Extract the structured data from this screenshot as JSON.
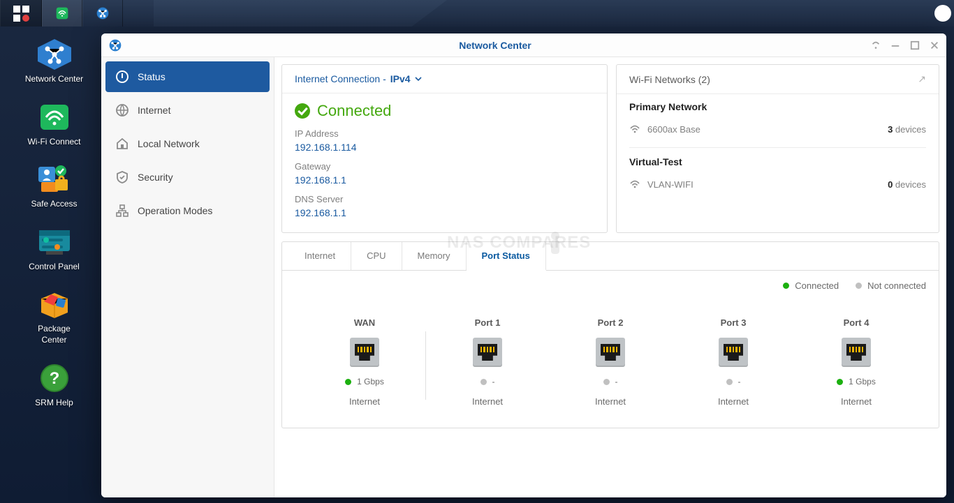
{
  "taskbar": {
    "items": [
      "dashboard",
      "wifi-connect",
      "network-center"
    ]
  },
  "desktop": [
    {
      "id": "network-center",
      "label": "Network Center"
    },
    {
      "id": "wifi-connect",
      "label": "Wi-Fi Connect"
    },
    {
      "id": "safe-access",
      "label": "Safe Access"
    },
    {
      "id": "control-panel",
      "label": "Control Panel"
    },
    {
      "id": "package-center",
      "label": "Package\nCenter"
    },
    {
      "id": "srm-help",
      "label": "SRM Help"
    }
  ],
  "window": {
    "title": "Network Center",
    "sidebar": [
      {
        "id": "status",
        "label": "Status",
        "active": true
      },
      {
        "id": "internet",
        "label": "Internet",
        "active": false
      },
      {
        "id": "local-net",
        "label": "Local Network",
        "active": false
      },
      {
        "id": "security",
        "label": "Security",
        "active": false
      },
      {
        "id": "op-modes",
        "label": "Operation Modes",
        "active": false
      }
    ],
    "conn_card": {
      "header_prefix": "Internet Connection - ",
      "header_mode": "IPv4",
      "status": "Connected",
      "fields": [
        {
          "k": "IP Address",
          "v": "192.168.1.114"
        },
        {
          "k": "Gateway",
          "v": "192.168.1.1"
        },
        {
          "k": "DNS Server",
          "v": "192.168.1.1"
        }
      ]
    },
    "wifi_card": {
      "header": "Wi-Fi Networks (2)",
      "sections": [
        {
          "title": "Primary Network",
          "ssid": "6600ax Base",
          "devices": "3",
          "devices_label": "devices"
        },
        {
          "title": "Virtual-Test",
          "ssid": "VLAN-WIFI",
          "devices": "0",
          "devices_label": "devices"
        }
      ]
    },
    "tabs": [
      {
        "id": "internet",
        "label": "Internet",
        "active": false
      },
      {
        "id": "cpu",
        "label": "CPU",
        "active": false
      },
      {
        "id": "memory",
        "label": "Memory",
        "active": false
      },
      {
        "id": "port",
        "label": "Port Status",
        "active": true
      }
    ],
    "legend": {
      "connected": "Connected",
      "notconnected": "Not connected"
    },
    "ports": [
      {
        "name": "WAN",
        "speed": "1 Gbps",
        "connected": true,
        "sub": "Internet",
        "sep": true
      },
      {
        "name": "Port 1",
        "speed": "-",
        "connected": false,
        "sub": "Internet",
        "sep": false
      },
      {
        "name": "Port 2",
        "speed": "-",
        "connected": false,
        "sub": "Internet",
        "sep": false
      },
      {
        "name": "Port 3",
        "speed": "-",
        "connected": false,
        "sub": "Internet",
        "sep": false
      },
      {
        "name": "Port 4",
        "speed": "1 Gbps",
        "connected": true,
        "sub": "Internet",
        "sep": false
      }
    ]
  },
  "watermark": "NAS COMPARES"
}
